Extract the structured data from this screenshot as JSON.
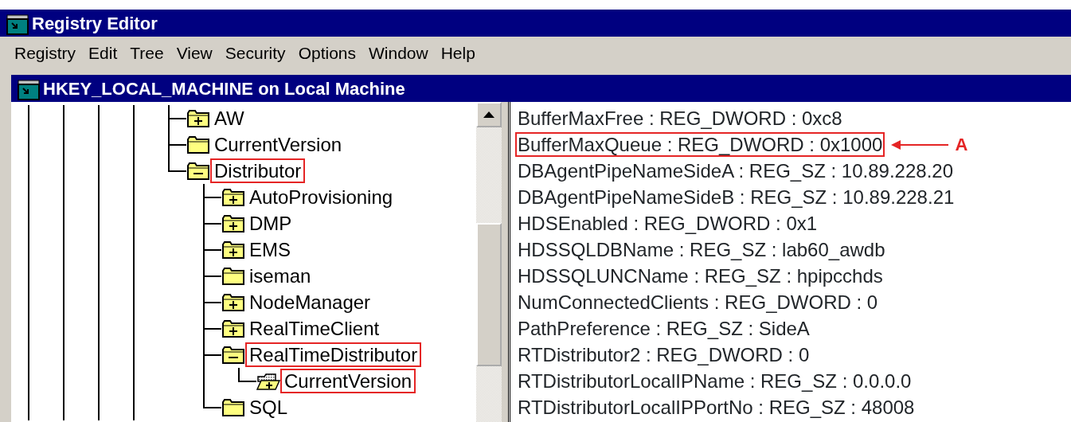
{
  "window": {
    "title": "Registry Editor"
  },
  "menu": [
    "Registry",
    "Edit",
    "Tree",
    "View",
    "Security",
    "Options",
    "Window",
    "Help"
  ],
  "child_window": {
    "title": "HKEY_LOCAL_MACHINE on Local Machine"
  },
  "tree": {
    "items": [
      {
        "label": "AW",
        "expandable": true,
        "expanded": false,
        "selected": false,
        "highlighted": false
      },
      {
        "label": "CurrentVersion",
        "expandable": false,
        "expanded": false,
        "selected": false,
        "highlighted": false
      },
      {
        "label": "Distributor",
        "expandable": true,
        "expanded": true,
        "selected": false,
        "highlighted": true,
        "children": [
          {
            "label": "AutoProvisioning",
            "expandable": true,
            "expanded": false,
            "selected": false,
            "highlighted": false
          },
          {
            "label": "DMP",
            "expandable": true,
            "expanded": false,
            "selected": false,
            "highlighted": false
          },
          {
            "label": "EMS",
            "expandable": true,
            "expanded": false,
            "selected": false,
            "highlighted": false
          },
          {
            "label": "iseman",
            "expandable": false,
            "expanded": false,
            "selected": false,
            "highlighted": false
          },
          {
            "label": "NodeManager",
            "expandable": true,
            "expanded": false,
            "selected": false,
            "highlighted": false
          },
          {
            "label": "RealTimeClient",
            "expandable": true,
            "expanded": false,
            "selected": false,
            "highlighted": false
          },
          {
            "label": "RealTimeDistributor",
            "expandable": true,
            "expanded": true,
            "selected": false,
            "highlighted": true,
            "children": [
              {
                "label": "CurrentVersion",
                "expandable": true,
                "expanded": false,
                "selected": true,
                "highlighted": true
              }
            ]
          },
          {
            "label": "SQL",
            "expandable": false,
            "expanded": false,
            "selected": false,
            "highlighted": false
          }
        ]
      }
    ]
  },
  "values": [
    {
      "text": "BufferMaxFree : REG_DWORD : 0xc8",
      "highlighted": false
    },
    {
      "text": "BufferMaxQueue : REG_DWORD : 0x1000",
      "highlighted": true,
      "annotation": "A"
    },
    {
      "text": "DBAgentPipeNameSideA : REG_SZ : 10.89.228.20",
      "highlighted": false
    },
    {
      "text": "DBAgentPipeNameSideB : REG_SZ : 10.89.228.21",
      "highlighted": false
    },
    {
      "text": "HDSEnabled : REG_DWORD : 0x1",
      "highlighted": false
    },
    {
      "text": "HDSSQLDBName : REG_SZ : lab60_awdb",
      "highlighted": false
    },
    {
      "text": "HDSSQLUNCName : REG_SZ : hpipcchds",
      "highlighted": false
    },
    {
      "text": "NumConnectedClients : REG_DWORD : 0",
      "highlighted": false
    },
    {
      "text": "PathPreference : REG_SZ : SideA",
      "highlighted": false
    },
    {
      "text": "RTDistributor2 : REG_DWORD : 0",
      "highlighted": false
    },
    {
      "text": "RTDistributorLocalIPName : REG_SZ : 0.0.0.0",
      "highlighted": false
    },
    {
      "text": "RTDistributorLocalIPPortNo : REG_SZ : 48008",
      "highlighted": false
    }
  ]
}
